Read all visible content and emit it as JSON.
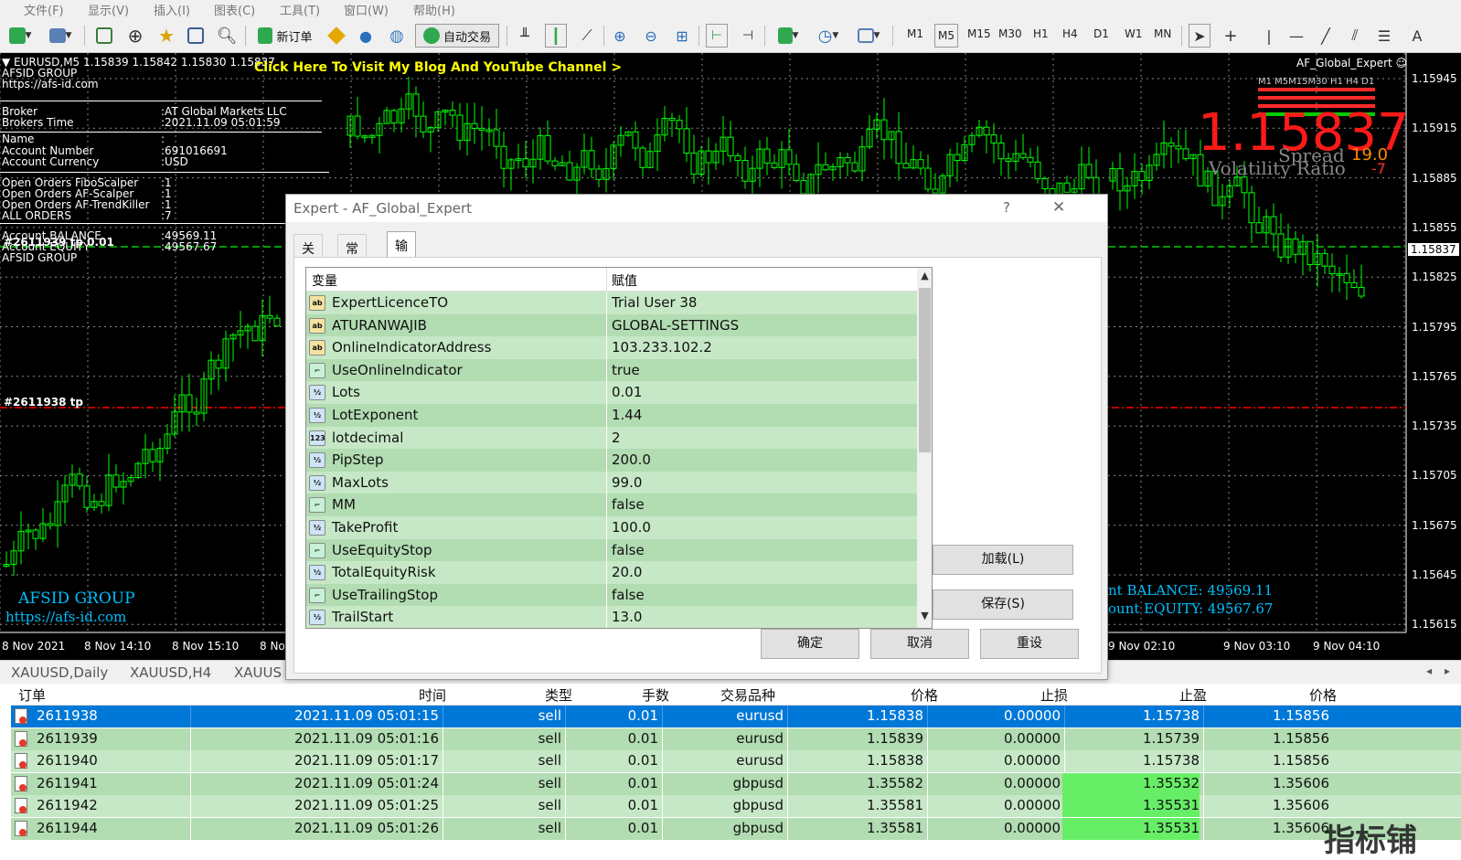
{
  "menu": [
    "文件(F)",
    "显示(V)",
    "插入(I)",
    "图表(C)",
    "工具(T)",
    "窗口(W)",
    "帮助(H)"
  ],
  "toolbar": {
    "new_order": "新订单",
    "auto_trade": "自动交易",
    "timeframes": [
      "M1",
      "M5",
      "M15",
      "M30",
      "H1",
      "H4",
      "D1",
      "W1",
      "MN"
    ],
    "active_tf": "M5"
  },
  "chart": {
    "symbol_line": "EURUSD,M5  1.15839 1.15842 1.15830 1.15837",
    "blog_link": "Click Here To Visit My Blog And YouTube Channel >",
    "expert_name": "AF_Global_Expert",
    "info_lines": [
      [
        "AFSID GROUP",
        ""
      ],
      [
        "https://afs-id.com",
        ""
      ],
      [
        "Broker",
        ":AT Global Markets LLC"
      ],
      [
        "Brokers Time",
        ":2021.11.09 05:01:59"
      ],
      [
        "Name",
        ":"
      ],
      [
        "Account Number",
        ":691016691"
      ],
      [
        "Account Currency",
        ":USD"
      ],
      [
        "Open Orders FiboScalper",
        ":1"
      ],
      [
        "Open Orders AF-Scalper",
        ":1"
      ],
      [
        "Open Orders AF-TrendKiller",
        ":1"
      ],
      [
        "ALL ORDERS",
        ":7"
      ],
      [
        "Account BALANCE",
        ":49569.11"
      ],
      [
        "Account EQUITY",
        ":49567.67"
      ],
      [
        "AFSID GROUP",
        ""
      ]
    ],
    "order_label_1": "#2611939 tp 0.01",
    "order_label_2": "#2611938 tp",
    "big_price": "1.15837",
    "spread_label": "Spread",
    "spread_value": "19.0",
    "volatility_label": "Volatility Ratio",
    "volatility_value": "-7",
    "mtf_labels": "M1 M5M15M30 H1 H4 D1",
    "afsid_footer": "AFSID GROUP",
    "afsid_url": "https://afs-id.com",
    "balance_text": "nt BALANCE:  49569.11",
    "equity_text": "ount EQUITY:  49567.67",
    "price_axis": [
      "1.15945",
      "1.15915",
      "1.15885",
      "1.15855",
      "1.15825",
      "1.15795",
      "1.15765",
      "1.15735",
      "1.15705",
      "1.15675",
      "1.15645",
      "1.15615"
    ],
    "current_price": "1.15837",
    "time_axis": [
      "8 Nov 2021",
      "8 Nov 14:10",
      "8 Nov 15:10",
      "8 No",
      "9 Nov 02:10",
      "9 Nov 03:10",
      "9 Nov 04:10"
    ]
  },
  "dialog": {
    "title": "Expert - AF_Global_Expert",
    "help": "?",
    "close": "✕",
    "tabs": [
      "关于",
      "常用",
      "输入参数"
    ],
    "active_tab": "输入参数",
    "col_variable": "变量",
    "col_value": "赋值",
    "params": [
      {
        "type": "ab",
        "name": "ExpertLicenceTO",
        "value": "Trial User 38"
      },
      {
        "type": "ab",
        "name": "ATURANWAJIB",
        "value": "GLOBAL-SETTINGS"
      },
      {
        "type": "ab",
        "name": "OnlineIndicatorAddress",
        "value": "103.233.102.2"
      },
      {
        "type": "bool",
        "name": "UseOnlineIndicator",
        "value": "true"
      },
      {
        "type": "v2",
        "name": "Lots",
        "value": "0.01"
      },
      {
        "type": "v2",
        "name": "LotExponent",
        "value": "1.44"
      },
      {
        "type": "123",
        "name": "lotdecimal",
        "value": "2"
      },
      {
        "type": "v2",
        "name": "PipStep",
        "value": "200.0"
      },
      {
        "type": "v2",
        "name": "MaxLots",
        "value": "99.0"
      },
      {
        "type": "bool",
        "name": "MM",
        "value": "false"
      },
      {
        "type": "v2",
        "name": "TakeProfit",
        "value": "100.0"
      },
      {
        "type": "bool",
        "name": "UseEquityStop",
        "value": "false"
      },
      {
        "type": "v2",
        "name": "TotalEquityRisk",
        "value": "20.0"
      },
      {
        "type": "bool",
        "name": "UseTrailingStop",
        "value": "false"
      },
      {
        "type": "v2",
        "name": "TrailStart",
        "value": "13.0"
      }
    ],
    "load_btn": "加载(L)",
    "save_btn": "保存(S)",
    "ok_btn": "确定",
    "cancel_btn": "取消",
    "reset_btn": "重设"
  },
  "bottom_tabs": [
    "XAUUSD,Daily",
    "XAUUSD,H4",
    "XAUUS"
  ],
  "orders": {
    "headers": [
      "订单",
      "时间",
      "类型",
      "手数",
      "交易品种",
      "价格",
      "止损",
      "止盈",
      "价格"
    ],
    "rows": [
      [
        "2611938",
        "2021.11.09 05:01:15",
        "sell",
        "0.01",
        "eurusd",
        "1.15838",
        "0.00000",
        "1.15738",
        "1.15856"
      ],
      [
        "2611939",
        "2021.11.09 05:01:16",
        "sell",
        "0.01",
        "eurusd",
        "1.15839",
        "0.00000",
        "1.15739",
        "1.15856"
      ],
      [
        "2611940",
        "2021.11.09 05:01:17",
        "sell",
        "0.01",
        "eurusd",
        "1.15838",
        "0.00000",
        "1.15738",
        "1.15856"
      ],
      [
        "2611941",
        "2021.11.09 05:01:24",
        "sell",
        "0.01",
        "gbpusd",
        "1.35582",
        "0.00000",
        "1.35532",
        "1.35606"
      ],
      [
        "2611942",
        "2021.11.09 05:01:25",
        "sell",
        "0.01",
        "gbpusd",
        "1.35581",
        "0.00000",
        "1.35531",
        "1.35606"
      ],
      [
        "2611944",
        "2021.11.09 05:01:26",
        "sell",
        "0.01",
        "gbpusd",
        "1.35581",
        "0.00000",
        "1.35531",
        "1.35606"
      ]
    ]
  },
  "watermark": "指标铺",
  "colors": {
    "candle": "#00ff00",
    "row_a": "#c6e8c6",
    "row_b": "#b2dcb2",
    "selected": "#0078d7",
    "tp_hit": "#66ee66",
    "big_price": "#ff1a1a"
  }
}
